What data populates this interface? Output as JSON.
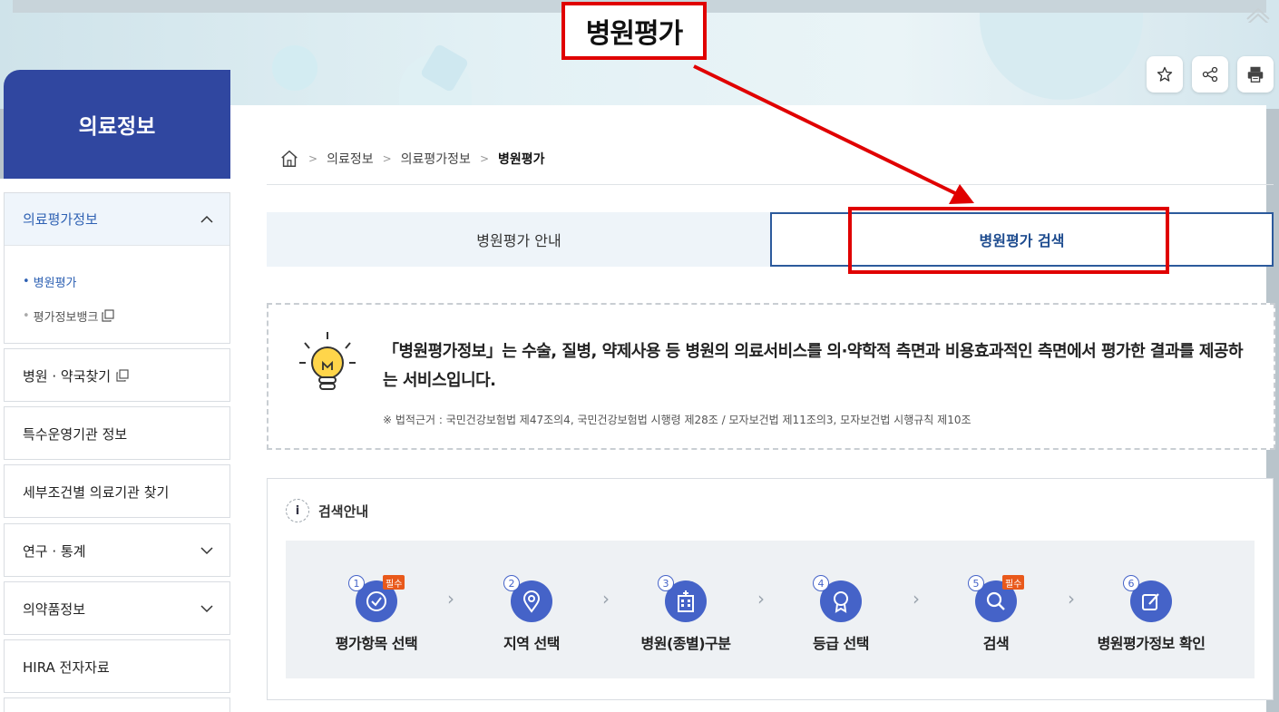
{
  "page": {
    "title": "병원평가"
  },
  "toolbar": {
    "favorite_icon": "star-icon",
    "share_icon": "share-icon",
    "print_icon": "print-icon"
  },
  "sidebar": {
    "title": "의료정보",
    "sections": [
      {
        "label": "의료평가정보",
        "expanded": true,
        "sub": [
          {
            "label": "병원평가",
            "selected": true
          },
          {
            "label": "평가정보뱅크",
            "external": true
          }
        ]
      },
      {
        "label": "병원 · 약국찾기",
        "external": true
      },
      {
        "label": "특수운영기관 정보"
      },
      {
        "label": "세부조건별 의료기관 찾기"
      },
      {
        "label": "연구 · 통계",
        "expandable": true
      },
      {
        "label": "의약품정보",
        "expandable": true
      },
      {
        "label": "HIRA 전자자료"
      }
    ]
  },
  "breadcrumb": {
    "items": [
      "의료정보",
      "의료평가정보"
    ],
    "current": "병원평가"
  },
  "tabs": {
    "guide": "병원평가 안내",
    "search": "병원평가 검색"
  },
  "info": {
    "description": "「병원평가정보」는 수술, 질병, 약제사용 등 병원의 의료서비스를 의·약학적 측면과 비용효과적인 측면에서 평가한 결과를 제공하는 서비스입니다.",
    "legal_note": "※ 법적근거 : 국민건강보험법 제47조의4, 국민건강보험법 시행령 제28조 / 모자보건법 제11조의3, 모자보건법 시행규칙 제10조"
  },
  "guide": {
    "title": "검색안내",
    "info_icon_label": "i",
    "required_badge": "필수",
    "steps": [
      {
        "num": "1",
        "label": "평가항목 선택",
        "required": true,
        "icon": "check-circle-icon"
      },
      {
        "num": "2",
        "label": "지역 선택",
        "required": false,
        "icon": "location-pin-icon"
      },
      {
        "num": "3",
        "label": "병원(종별)구분",
        "required": false,
        "icon": "hospital-building-icon"
      },
      {
        "num": "4",
        "label": "등급 선택",
        "required": false,
        "icon": "award-badge-icon"
      },
      {
        "num": "5",
        "label": "검색",
        "required": true,
        "icon": "search-icon"
      },
      {
        "num": "6",
        "label": "병원평가정보 확인",
        "required": false,
        "icon": "edit-document-icon"
      }
    ]
  },
  "colors": {
    "sidebar_header": "#3047a0",
    "accent_blue": "#2c5a9c",
    "step_circle": "#4563c8",
    "required_badge": "#e9591b",
    "annotation_red": "#e00000"
  }
}
